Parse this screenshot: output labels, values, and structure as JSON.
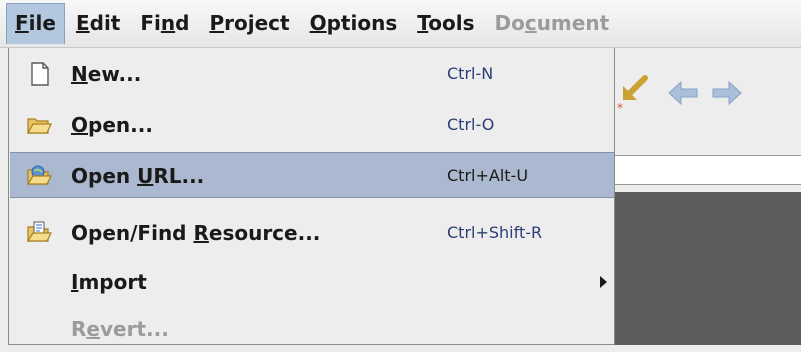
{
  "menubar": {
    "items": [
      {
        "label": "File",
        "mnemonic": "F",
        "rest": "ile",
        "pre": ""
      },
      {
        "label": "Edit",
        "mnemonic": "E",
        "rest": "dit",
        "pre": ""
      },
      {
        "label": "Find",
        "pre": "Fi",
        "mnemonic": "n",
        "rest": "d"
      },
      {
        "label": "Project",
        "mnemonic": "P",
        "rest": "roject",
        "pre": ""
      },
      {
        "label": "Options",
        "mnemonic": "O",
        "rest": "ptions",
        "pre": ""
      },
      {
        "label": "Tools",
        "mnemonic": "T",
        "rest": "ools",
        "pre": ""
      },
      {
        "label": "Document",
        "pre": "Do",
        "mnemonic": "c",
        "rest": "ument"
      }
    ]
  },
  "file_menu": {
    "items": [
      {
        "pre": "",
        "mnemonic": "N",
        "rest": "ew...",
        "accel": "Ctrl-N",
        "icon": "new-file-icon"
      },
      {
        "pre": "",
        "mnemonic": "O",
        "rest": "pen...",
        "accel": "Ctrl-O",
        "icon": "open-folder-icon"
      },
      {
        "pre": "Open ",
        "mnemonic": "U",
        "rest": "RL...",
        "accel": "Ctrl+Alt-U",
        "icon": "open-url-icon"
      },
      {
        "pre": "Open/Find ",
        "mnemonic": "R",
        "rest": "esource...",
        "accel": "Ctrl+Shift-R",
        "icon": "open-resource-icon"
      },
      {
        "pre": "",
        "mnemonic": "I",
        "rest": "mport",
        "accel": "",
        "icon": ""
      },
      {
        "pre": "R",
        "mnemonic": "e",
        "rest": "vert...",
        "accel": "",
        "icon": ""
      }
    ]
  },
  "colors": {
    "highlight": "#aab9cf",
    "menu_active": "#b3c7de",
    "accelerator": "#2c3e75"
  }
}
